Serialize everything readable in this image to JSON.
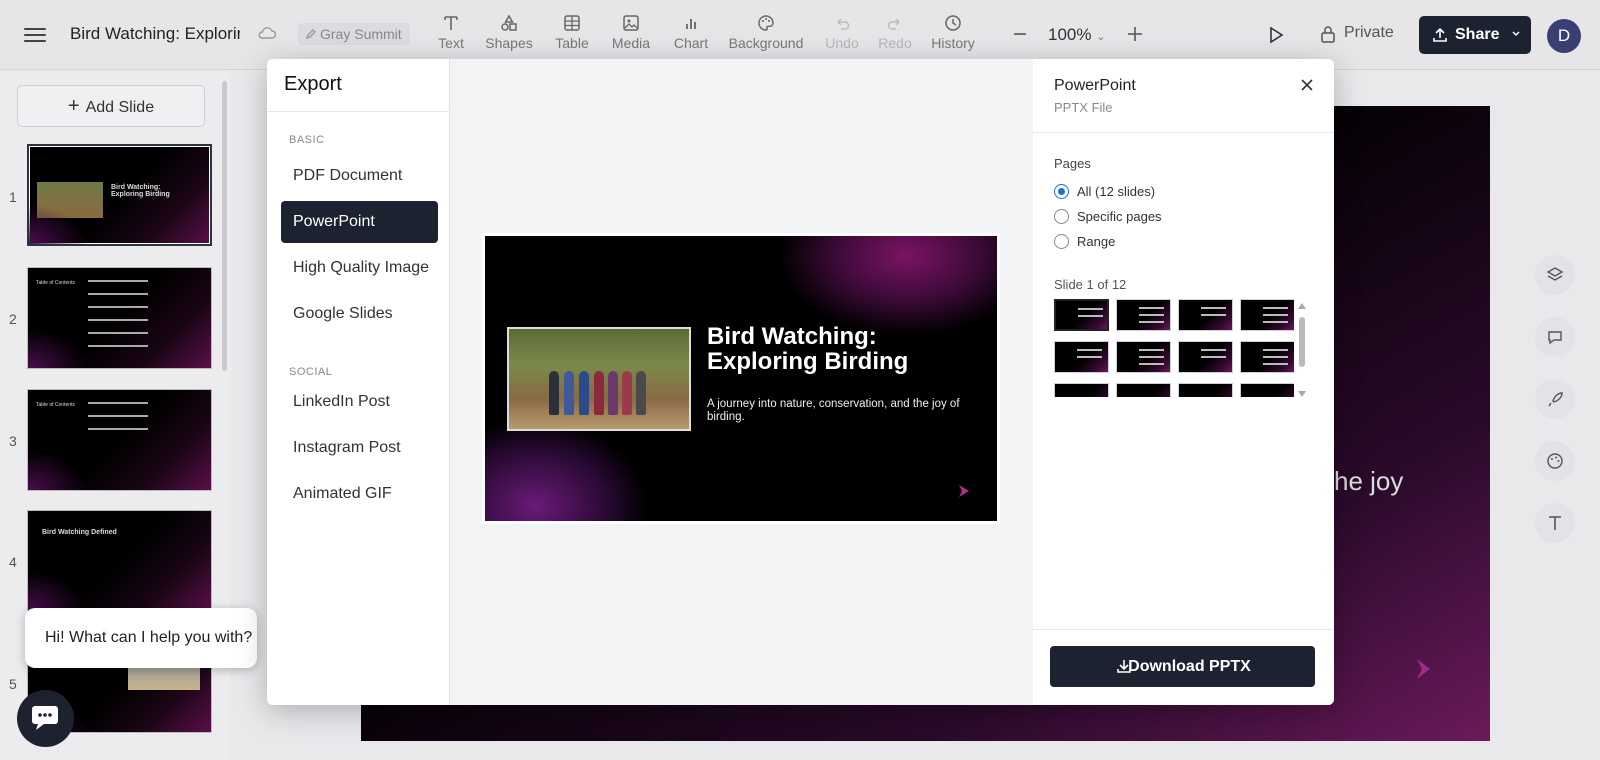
{
  "topbar": {
    "doc_title": "Bird Watching: Exploring",
    "workspace": "Gray Summit",
    "tools": [
      {
        "label": "Text",
        "icon": "text-icon",
        "disabled": false
      },
      {
        "label": "Shapes",
        "icon": "shapes-icon",
        "disabled": false
      },
      {
        "label": "Table",
        "icon": "table-icon",
        "disabled": false
      },
      {
        "label": "Media",
        "icon": "image-icon",
        "disabled": false
      },
      {
        "label": "Chart",
        "icon": "chart-icon",
        "disabled": false
      },
      {
        "label": "Background",
        "icon": "palette-icon",
        "disabled": false
      },
      {
        "label": "Undo",
        "icon": "undo-icon",
        "disabled": true
      },
      {
        "label": "Redo",
        "icon": "redo-icon",
        "disabled": true
      },
      {
        "label": "History",
        "icon": "clock-icon",
        "disabled": false
      }
    ],
    "zoom": "100%",
    "private_label": "Private",
    "share_label": "Share",
    "avatar_initial": "D"
  },
  "rail": {
    "add_slide_label": "Add Slide",
    "slides": [
      {
        "num": "1"
      },
      {
        "num": "2"
      },
      {
        "num": "3"
      },
      {
        "num": "4"
      },
      {
        "num": "5"
      }
    ]
  },
  "canvas": {
    "visible_text": "he joy"
  },
  "chat": {
    "bubble_text": "Hi! What can I help you with?"
  },
  "export_dialog": {
    "title": "Export",
    "sections": {
      "basic": "BASIC",
      "social": "SOCIAL"
    },
    "basic_items": [
      "PDF Document",
      "PowerPoint",
      "High Quality Image",
      "Google Slides"
    ],
    "social_items": [
      "LinkedIn Post",
      "Instagram Post",
      "Animated GIF"
    ],
    "selected_format": "PowerPoint",
    "preview": {
      "title": "Bird Watching: Exploring Birding",
      "subtitle": "A journey into nature, conservation, and the joy of birding."
    },
    "options": {
      "format_name": "PowerPoint",
      "format_sub": "PPTX File",
      "pages_label": "Pages",
      "page_choices": [
        "All (12 slides)",
        "Specific pages",
        "Range"
      ],
      "selected_choice": "All (12 slides)",
      "slide_counter": "Slide 1 of 12",
      "download_label": "Download PPTX"
    }
  },
  "colors": {
    "accent_dark": "#1c2230",
    "radio_blue": "#1f6fe0",
    "slide_magenta": "#7a1465"
  }
}
